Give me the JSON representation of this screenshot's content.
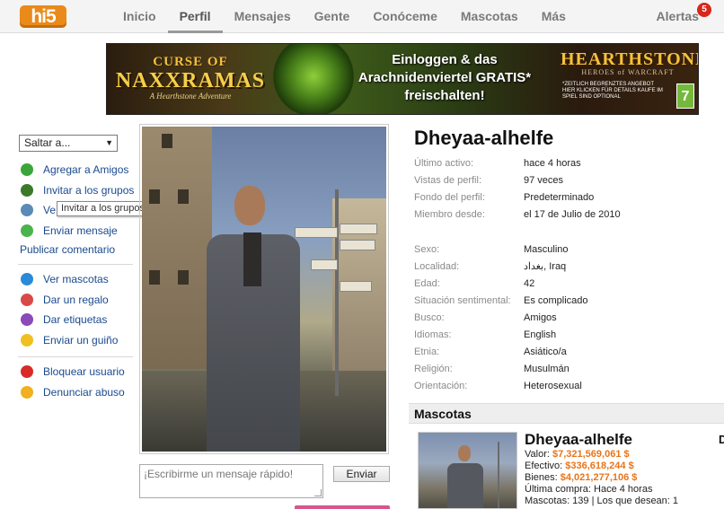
{
  "nav": {
    "logo": "hi5",
    "items": [
      "Inicio",
      "Perfil",
      "Mensajes",
      "Gente",
      "Conóceme",
      "Mascotas",
      "Más"
    ],
    "active_index": 1,
    "alerts_label": "Alertas",
    "alerts_count": "5"
  },
  "banner": {
    "left_title_top": "CURSE OF",
    "left_title_main": "NAXXRAMAS",
    "left_subtitle": "A Hearthstone Adventure",
    "mid_line1": "Einloggen & das",
    "mid_line2": "Arachnidenviertel GRATIS*",
    "mid_line3": "freischalten!",
    "right_brand": "HEARTHSTONE",
    "right_subbrand": "HEROES of WARCRAFT",
    "right_small": "*ZEITLICH BEGRENZTES ANGEBOT HIER KLICKEN FÜR DETAILS KAUFE IM SPIEL SIND OPTIONAL",
    "rating": "7"
  },
  "sidebar": {
    "select_label": "Saltar a...",
    "group1": [
      {
        "label": "Agregar a Amigos",
        "icon": "add-friend-icon",
        "color": "#3aa53a"
      },
      {
        "label": "Invitar a los grupos",
        "icon": "invite-groups-icon",
        "color": "#3a7a2a"
      },
      {
        "label": "Ve",
        "icon": "camera-icon",
        "color": "#5a8ab8"
      },
      {
        "label": "Enviar mensaje",
        "icon": "message-bubble-icon",
        "color": "#4bb34b"
      }
    ],
    "comment_label": "Publicar comentario",
    "group2": [
      {
        "label": "Ver mascotas",
        "icon": "pet-tag-icon",
        "color": "#2a8ad8"
      },
      {
        "label": "Dar un regalo",
        "icon": "gift-icon",
        "color": "#d84a4a"
      },
      {
        "label": "Dar etiquetas",
        "icon": "star-tag-icon",
        "color": "#8a4ab8"
      },
      {
        "label": "Enviar un guiño",
        "icon": "wink-smiley-icon",
        "color": "#f0c020"
      }
    ],
    "group3": [
      {
        "label": "Bloquear usuario",
        "icon": "block-icon",
        "color": "#d82a2a"
      },
      {
        "label": "Denunciar abuso",
        "icon": "warning-icon",
        "color": "#f0b020"
      }
    ],
    "tooltip": "Invitar a los grupos"
  },
  "message": {
    "placeholder": "¡Escribirme un mensaje rápido!",
    "send_label": "Enviar"
  },
  "profile": {
    "name": "Dheyaa-alhelfe",
    "stats": [
      {
        "k": "Último activo:",
        "v": "hace 4 horas"
      },
      {
        "k": "Vistas de perfil:",
        "v": "97 veces"
      },
      {
        "k": "Fondo del perfil:",
        "v": "Predeterminado"
      },
      {
        "k": "Miembro desde:",
        "v": "el 17 de Julio de 2010"
      }
    ],
    "details": [
      {
        "k": "Sexo:",
        "v": "Masculino"
      },
      {
        "k": "Localidad:",
        "v": "بغداد, Iraq"
      },
      {
        "k": "Edad:",
        "v": "42"
      },
      {
        "k": "Situación sentimental:",
        "v": "Es complicado"
      },
      {
        "k": "Busco:",
        "v": "Amigos"
      },
      {
        "k": "Idiomas:",
        "v": "English"
      },
      {
        "k": "Etnia:",
        "v": "Asiático/a"
      },
      {
        "k": "Religión:",
        "v": "Musulmán"
      },
      {
        "k": "Orientación:",
        "v": "Heterosexual"
      }
    ]
  },
  "mascotas": {
    "title": "Mascotas",
    "name": "Dheyaa-alhelfe",
    "valor_label": "Valor:",
    "valor": "$7,321,569,061 $",
    "efectivo_label": "Efectivo:",
    "efectivo": "$336,618,244 $",
    "bienes_label": "Bienes:",
    "bienes": "$4,021,277,106 $",
    "ultima": "Última compra: Hace 4 horas",
    "count": "Mascotas: 139 | Los que desean: 1",
    "edge_letter": "D"
  }
}
